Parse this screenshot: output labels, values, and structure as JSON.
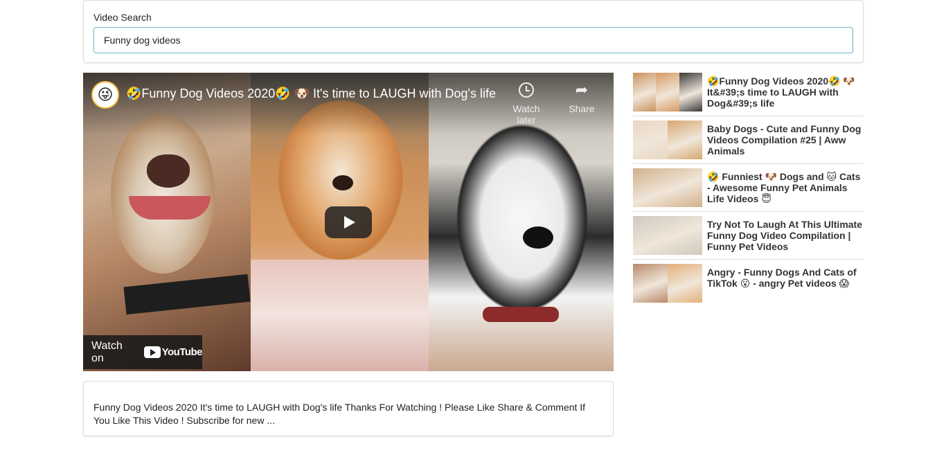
{
  "search": {
    "label": "Video Search",
    "value": "Funny dog videos"
  },
  "player": {
    "channel_avatar": "😜",
    "title": "🤣Funny Dog Videos 2020🤣 🐶 It's time to LAUGH with Dog's life",
    "watch_later_label": "Watch later",
    "share_label": "Share",
    "watch_on_label": "Watch on",
    "youtube_label": "YouTube"
  },
  "description": {
    "text": "Funny Dog Videos 2020 It's time to LAUGH with Dog's life Thanks For Watching ! Please Like Share & Comment If You Like This Video ! Subscribe for new ..."
  },
  "video_list": {
    "items": [
      {
        "title": "🤣Funny Dog Videos 2020🤣 🐶 It&#39;s time to LAUGH with Dog&#39;s life",
        "thumb_colors": [
          "#c9935f",
          "#d69a60",
          "#3a3a3a"
        ]
      },
      {
        "title": "Baby Dogs - Cute and Funny Dog Videos Compilation #25 | Aww Animals",
        "thumb_colors": [
          "#e9d8c3",
          "#d7a870"
        ]
      },
      {
        "title": "🤣 Funniest 🐶 Dogs and 🐱 Cats - Awesome Funny Pet Animals Life Videos 😇",
        "thumb_colors": [
          "#d2b08a",
          "#a07850"
        ]
      },
      {
        "title": "Try Not To Laugh At This Ultimate Funny Dog Video Compilation | Funny Pet Videos",
        "thumb_colors": [
          "#cfc9bd",
          "#7b6a58"
        ]
      },
      {
        "title": "Angry - Funny Dogs And Cats of TikTok 😮 - angry Pet videos 😱",
        "thumb_colors": [
          "#b88a6a",
          "#e3b07a"
        ]
      }
    ]
  }
}
